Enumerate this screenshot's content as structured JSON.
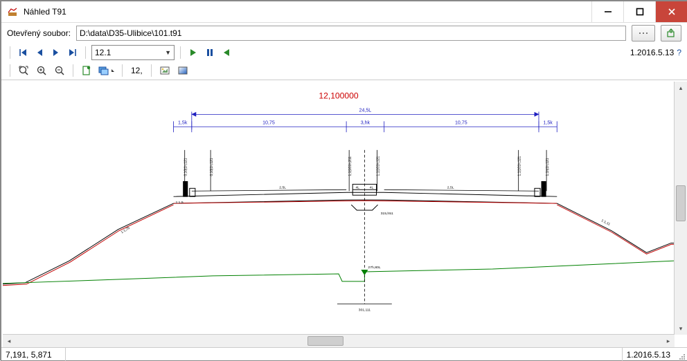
{
  "window": {
    "title": "Náhled T91"
  },
  "filebar": {
    "label": "Otevřený soubor:",
    "path": "D:\\data\\D35-Ulibice\\101.t91"
  },
  "navbar": {
    "combo_value": "12.1",
    "version": "1.2016.5.13",
    "help": "?"
  },
  "zoombar": {
    "label": "12,"
  },
  "drawing": {
    "km_label": "12,100000",
    "top_span": "24,5L",
    "spans": [
      "1,5k",
      "10,75",
      "3,hk",
      "10,75",
      "1,5k"
    ],
    "lane_labels": [
      "2,5L",
      "4L",
      "4L",
      "2,5L"
    ],
    "elev": "27h,80L",
    "bottom": "301,111",
    "slope_left": "1:1,75",
    "slope_right": "1:1,11",
    "width_small": "315,h51",
    "pillar_labels": [
      "0,10|1h,121",
      "0,10|1h,121",
      "1,1|101h,211",
      "1,1|101h,121",
      "1,1|101h,121",
      "1,1h|1h,121"
    ],
    "leg": "1:1,5"
  },
  "status": {
    "coords": "7,191,  5,871",
    "version": "1.2016.5.13"
  },
  "icons": {
    "first": "first",
    "prev": "prev",
    "next": "next",
    "last": "last",
    "play": "play",
    "pause": "pause",
    "back": "back",
    "zoom_extents": "zoom-extents",
    "zoom_in": "zoom-in",
    "zoom_out": "zoom-out",
    "page": "page",
    "layers": "layers",
    "picture": "picture",
    "gradient": "gradient"
  }
}
